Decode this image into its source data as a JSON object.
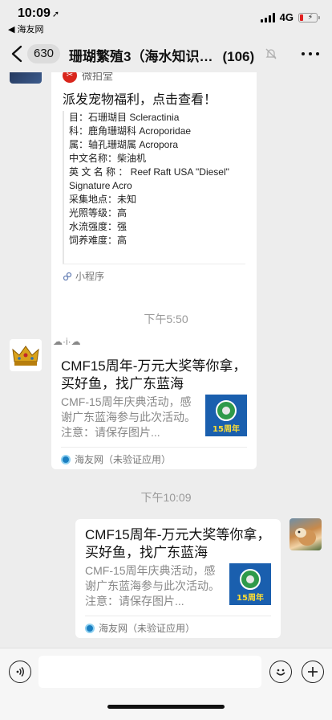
{
  "status_bar": {
    "time": "10:09",
    "location_arrow": "➚",
    "back_app": "◀ 海友网",
    "network": "4G"
  },
  "nav": {
    "unread_count": "630",
    "title": "珊瑚繁殖3（海水知识…",
    "member_count": "(106)"
  },
  "messages": {
    "mini_program": {
      "source": "微拍堂",
      "title": "派发宠物福利，点击查看！",
      "lines": [
        "目：石珊瑚目 Scleractinia",
        "科：鹿角珊瑚科 Acroporidae",
        "属：轴孔珊瑚属 Acropora",
        "中文名称：柴油机",
        "英 文 名 称 ： Reef Raft USA \"Diesel\"",
        "Signature Acro",
        "采集地点：未知",
        "光照等级：高",
        "水流强度：强",
        "饲养难度：高"
      ],
      "footer": "小程序"
    },
    "timestamp_1": "下午5:50",
    "sender_nickname": "☁·i·☁",
    "link_1": {
      "title": "CMF15周年-万元大奖等你拿，买好鱼，找广东蓝海",
      "desc": "CMF-15周年庆典活动，感谢广东蓝海参与此次活动。注意：请保存图片...",
      "thumb_text": "15周年",
      "source": "海友网（未验证应用）"
    },
    "timestamp_2": "下午10:09",
    "link_2": {
      "title": "CMF15周年-万元大奖等你拿，买好鱼，找广东蓝海",
      "desc": "CMF-15周年庆典活动，感谢广东蓝海参与此次活动。注意：请保存图片...",
      "thumb_text": "15周年",
      "source": "海友网（未验证应用）"
    }
  },
  "colors": {
    "background": "#ededed",
    "card": "#ffffff",
    "accent_red": "#d9261c",
    "thumb_blue": "#1663b3",
    "timestamp": "#9a9a9a"
  },
  "icons": [
    "back-chevron-icon",
    "mute-bell-icon",
    "more-dots-icon",
    "voice-icon",
    "emoji-icon",
    "plus-icon",
    "mini-program-icon"
  ]
}
